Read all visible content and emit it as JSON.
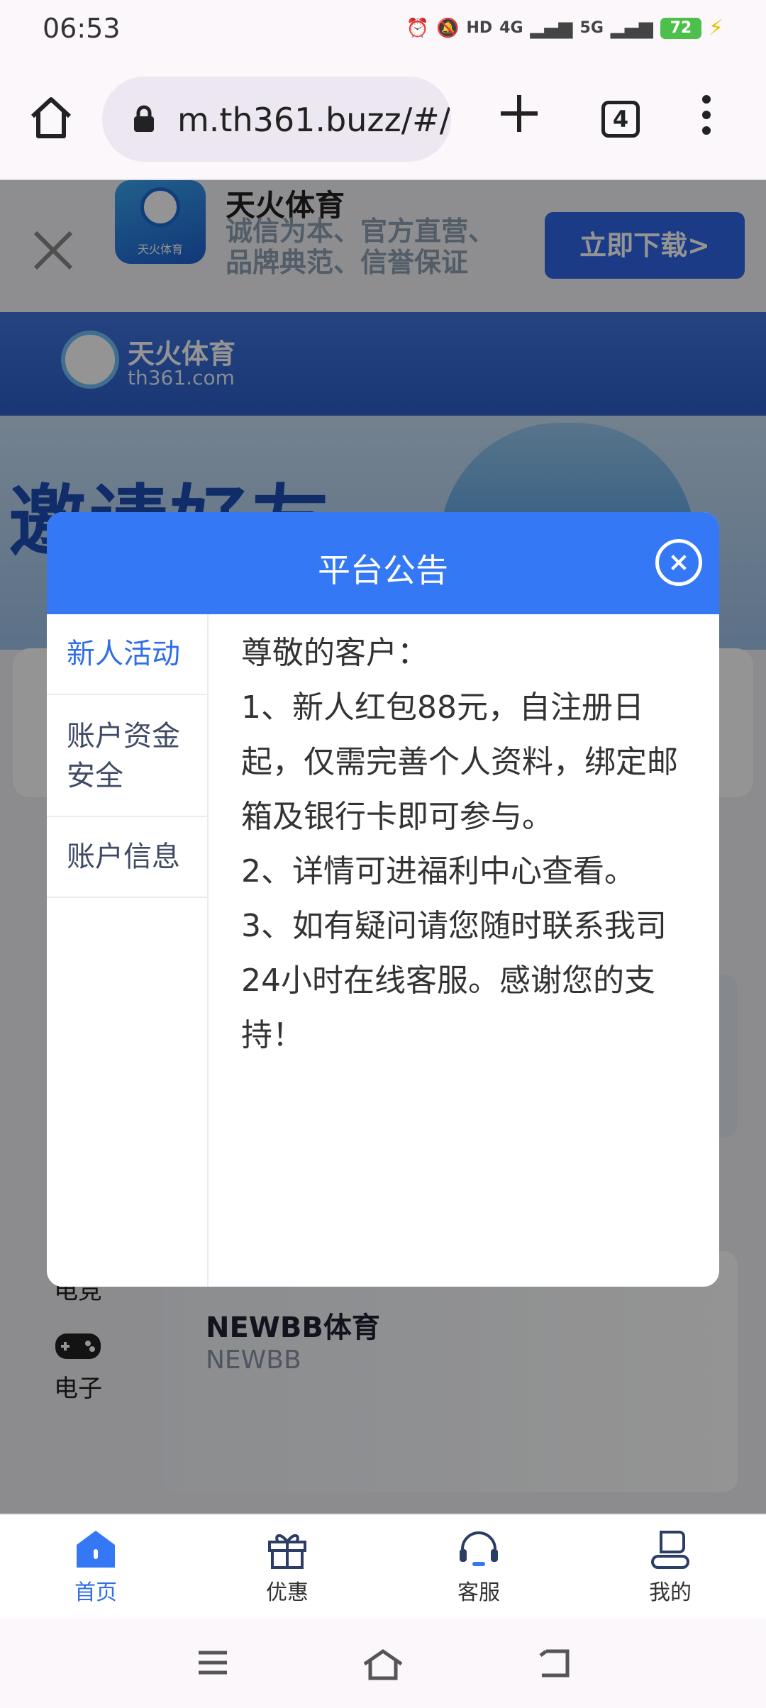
{
  "status_bar": {
    "time": "06:53",
    "network_1": "4G",
    "network_2": "5G",
    "hd_label": "HD",
    "battery": "72"
  },
  "browser": {
    "url": "m.th361.buzz/#/",
    "tab_count": "4"
  },
  "download_banner": {
    "app_name": "天火体育",
    "logo_text": "天火体育",
    "tagline": "诚信为本、官方直营、品牌典范、信誉保证",
    "button": "立即下载>"
  },
  "site_header": {
    "name": "天火体育",
    "domain": "th361.com"
  },
  "hero": {
    "text": "邀请好友"
  },
  "background": {
    "categories": [
      {
        "label": "电竞"
      },
      {
        "label": "电子"
      }
    ],
    "game_card": {
      "title": "NEWBB体育",
      "subtitle": "NEWBB"
    }
  },
  "modal": {
    "title": "平台公告",
    "tabs": [
      {
        "label": "新人活动",
        "active": true
      },
      {
        "label": "账户资金安全",
        "active": false
      },
      {
        "label": "账户信息",
        "active": false
      }
    ],
    "content": [
      "尊敬的客户：",
      "1、新人红包88元，自注册日起，仅需完善个人资料，绑定邮箱及银行卡即可参与。",
      "2、详情可进福利中心查看。",
      "3、如有疑问请您随时联系我司24小时在线客服。感谢您的支持！"
    ]
  },
  "bottom_nav": [
    {
      "label": "首页",
      "icon": "home-icon",
      "active": true
    },
    {
      "label": "优惠",
      "icon": "gift-icon",
      "active": false
    },
    {
      "label": "客服",
      "icon": "headset-icon",
      "active": false
    },
    {
      "label": "我的",
      "icon": "user-icon",
      "active": false
    }
  ],
  "colors": {
    "accent": "#3478f6",
    "active_tab": "#2f6ee5",
    "download_button": "#2f66e7",
    "battery": "#4cc04a"
  }
}
